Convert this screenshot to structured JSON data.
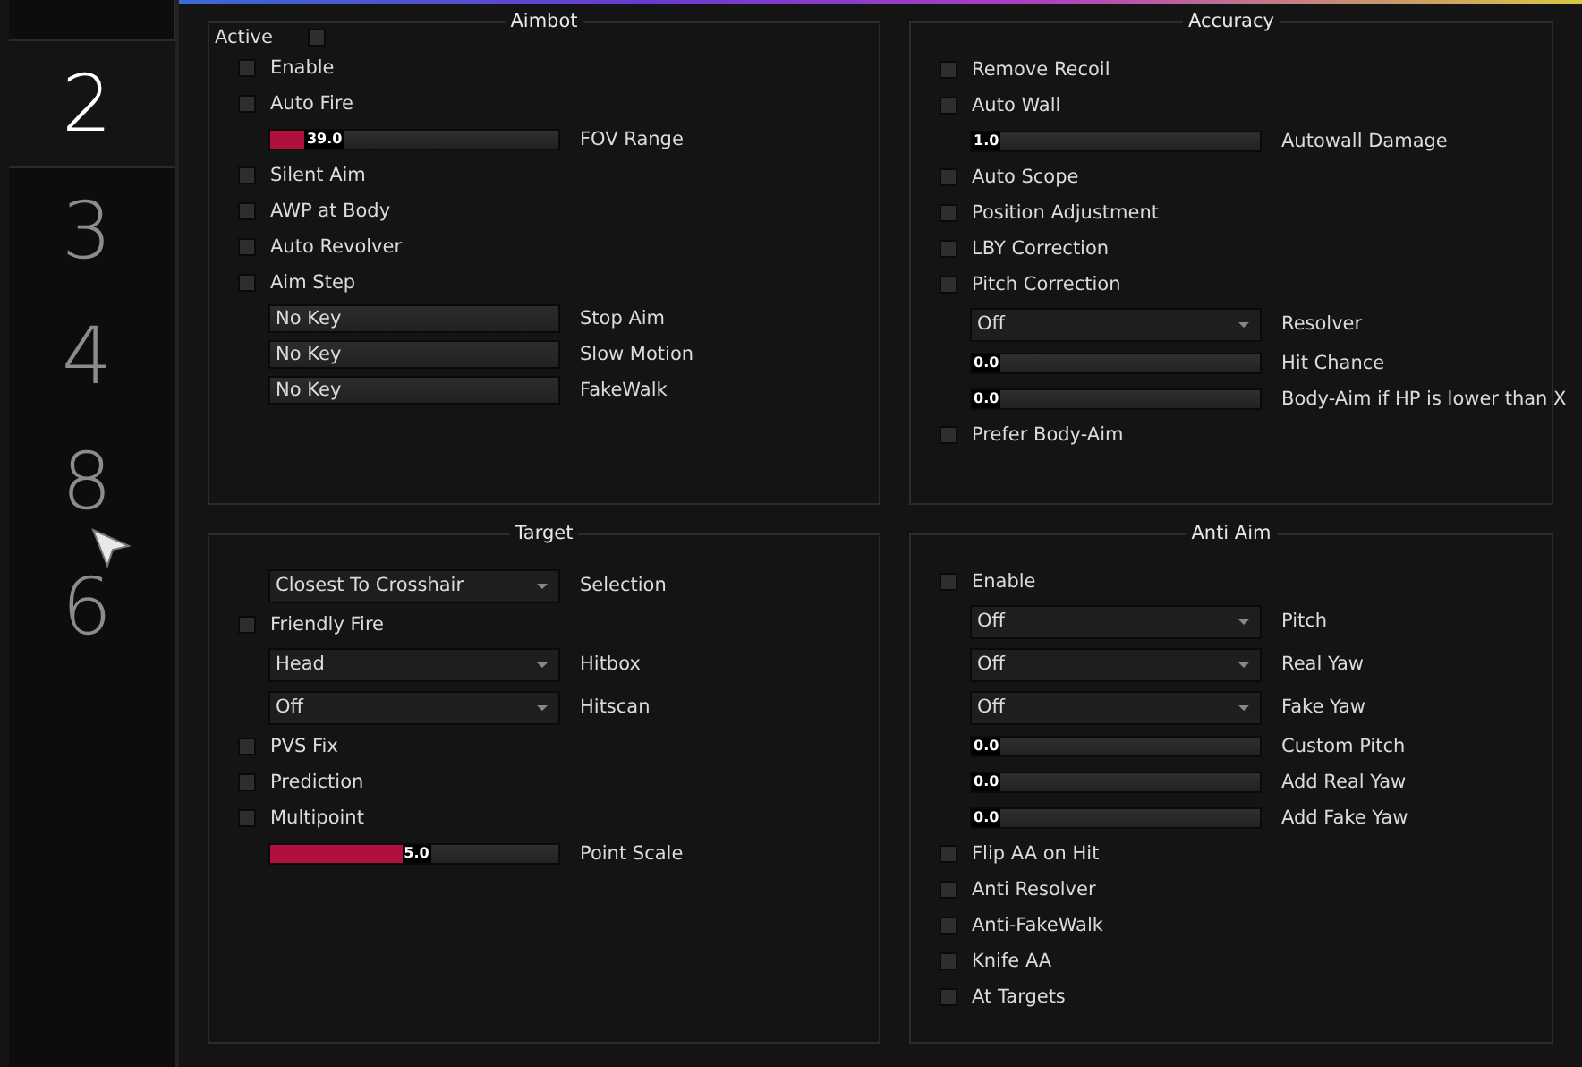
{
  "tabs": [
    {
      "label": "2",
      "selected": true
    },
    {
      "label": "3",
      "selected": false
    },
    {
      "label": "4",
      "selected": false
    },
    {
      "label": "8",
      "selected": false
    },
    {
      "label": "6",
      "selected": false
    }
  ],
  "groups": [
    {
      "title": "Aimbot",
      "items": [
        {
          "kind": "header-checkbox",
          "label": "Active",
          "checked": false
        },
        {
          "kind": "checkbox",
          "label": "Enable",
          "checked": false
        },
        {
          "kind": "checkbox",
          "label": "Auto Fire",
          "checked": false
        },
        {
          "kind": "slider",
          "label": "FOV Range",
          "reading": "39.0",
          "level": 0.14
        },
        {
          "kind": "checkbox",
          "label": "Silent Aim",
          "checked": false
        },
        {
          "kind": "checkbox",
          "label": "AWP at Body",
          "checked": false
        },
        {
          "kind": "checkbox",
          "label": "Auto Revolver",
          "checked": false
        },
        {
          "kind": "checkbox",
          "label": "Aim Step",
          "checked": false
        },
        {
          "kind": "keybind",
          "label": "Stop Aim",
          "key": "No Key"
        },
        {
          "kind": "keybind",
          "label": "Slow Motion",
          "key": "No Key"
        },
        {
          "kind": "keybind",
          "label": "FakeWalk",
          "key": "No Key"
        }
      ]
    },
    {
      "title": "Accuracy",
      "items": [
        {
          "kind": "checkbox",
          "label": "Remove Recoil",
          "checked": false
        },
        {
          "kind": "checkbox",
          "label": "Auto Wall",
          "checked": false
        },
        {
          "kind": "slider",
          "label": "Autowall Damage",
          "reading": "1.0",
          "level": 0
        },
        {
          "kind": "checkbox",
          "label": "Auto Scope",
          "checked": false
        },
        {
          "kind": "checkbox",
          "label": "Position Adjustment",
          "checked": false
        },
        {
          "kind": "checkbox",
          "label": "LBY Correction",
          "checked": false
        },
        {
          "kind": "checkbox",
          "label": "Pitch Correction",
          "checked": false
        },
        {
          "kind": "dropdown",
          "label": "Resolver",
          "selection": "Off"
        },
        {
          "kind": "slider",
          "label": "Hit Chance",
          "reading": "0.0",
          "level": 0
        },
        {
          "kind": "slider",
          "label": "Body-Aim if HP is lower than X",
          "reading": "0.0",
          "level": 0
        },
        {
          "kind": "checkbox",
          "label": "Prefer Body-Aim",
          "checked": false
        }
      ]
    },
    {
      "title": "Target",
      "items": [
        {
          "kind": "dropdown",
          "label": "Selection",
          "selection": "Closest To Crosshair"
        },
        {
          "kind": "checkbox",
          "label": "Friendly Fire",
          "checked": false
        },
        {
          "kind": "dropdown",
          "label": "Hitbox",
          "selection": "Head"
        },
        {
          "kind": "dropdown",
          "label": "Hitscan",
          "selection": "Off"
        },
        {
          "kind": "checkbox",
          "label": "PVS Fix",
          "checked": false
        },
        {
          "kind": "checkbox",
          "label": "Prediction",
          "checked": false
        },
        {
          "kind": "checkbox",
          "label": "Multipoint",
          "checked": false
        },
        {
          "kind": "slider",
          "label": "Point Scale",
          "reading": "5.0",
          "level": 0.53
        }
      ]
    },
    {
      "title": "Anti Aim",
      "items": [
        {
          "kind": "checkbox",
          "label": "Enable",
          "checked": false
        },
        {
          "kind": "dropdown",
          "label": "Pitch",
          "selection": "Off"
        },
        {
          "kind": "dropdown",
          "label": "Real Yaw",
          "selection": "Off"
        },
        {
          "kind": "dropdown",
          "label": "Fake Yaw",
          "selection": "Off"
        },
        {
          "kind": "slider",
          "label": "Custom Pitch",
          "reading": "0.0",
          "level": 0
        },
        {
          "kind": "slider",
          "label": "Add Real Yaw",
          "reading": "0.0",
          "level": 0
        },
        {
          "kind": "slider",
          "label": "Add Fake Yaw",
          "reading": "0.0",
          "level": 0
        },
        {
          "kind": "checkbox",
          "label": "Flip AA on Hit",
          "checked": false
        },
        {
          "kind": "checkbox",
          "label": "Anti Resolver",
          "checked": false
        },
        {
          "kind": "checkbox",
          "label": "Anti-FakeWalk",
          "checked": false
        },
        {
          "kind": "checkbox",
          "label": "Knife AA",
          "checked": false
        },
        {
          "kind": "checkbox",
          "label": "At Targets",
          "checked": false
        }
      ]
    }
  ]
}
